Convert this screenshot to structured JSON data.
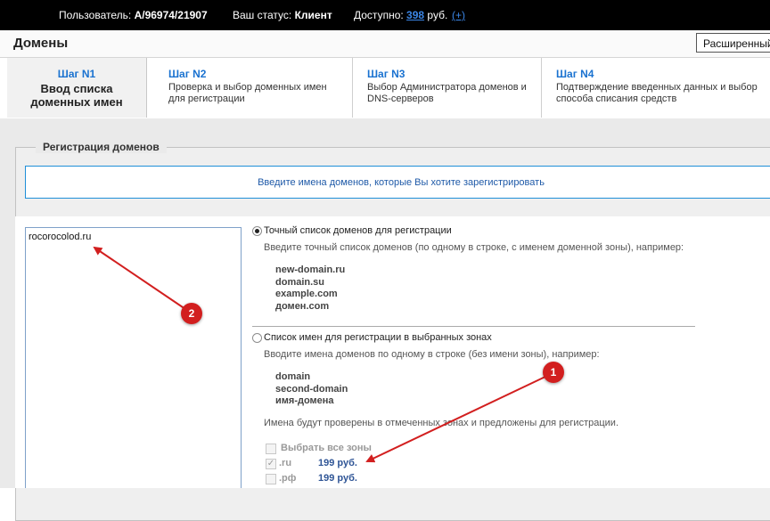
{
  "topbar": {
    "user_label": "Пользователь:",
    "user_value": "A/96974/21907",
    "status_label": "Ваш статус:",
    "status_value": "Клиент",
    "balance_label": "Доступно:",
    "balance_value": "398",
    "balance_currency": "руб.",
    "topup_label": "(+)"
  },
  "header": {
    "title": "Домены",
    "advanced_button": "Расширенный и"
  },
  "steps": [
    {
      "num": "Шаг N1",
      "desc": "Ввод списка доменных имен",
      "active": true
    },
    {
      "num": "Шаг N2",
      "desc": "Проверка и выбор доменных имен для регистрации",
      "active": false
    },
    {
      "num": "Шаг N3",
      "desc": "Выбор Администратора доменов и DNS-серверов",
      "active": false
    },
    {
      "num": "Шаг N4",
      "desc": "Подтверждение введенных данных и выбор способа списания средств",
      "active": false
    }
  ],
  "form": {
    "legend": "Регистрация доменов",
    "info": "Введите имена доменов, которые Вы хотите зарегистрировать",
    "textarea_value": "rocorocolod.ru",
    "option_exact": {
      "label": "Точный список доменов для регистрации",
      "hint": "Введите точный список доменов (по одному в строке, с именем доменной зоны), например:",
      "examples": [
        "new-domain.ru",
        "domain.su",
        "example.com",
        "домен.com"
      ],
      "selected": true
    },
    "option_zones": {
      "label": "Список имен для регистрации в выбранных зонах",
      "hint": "Вводите имена доменов по одному в строке (без имени зоны), например:",
      "examples": [
        "domain",
        "second-domain",
        "имя-домена"
      ],
      "note": "Имена будут проверены в отмеченных зонах и предложены для регистрации.",
      "selected": false
    },
    "select_all_label": "Выбрать все зоны",
    "zones": [
      {
        "name": ".ru",
        "price": "199 руб.",
        "checked": true
      },
      {
        "name": ".рф",
        "price": "199 руб.",
        "checked": false
      }
    ]
  },
  "annotations": {
    "badge1": "1",
    "badge2": "2",
    "color": "#d21f1f"
  }
}
